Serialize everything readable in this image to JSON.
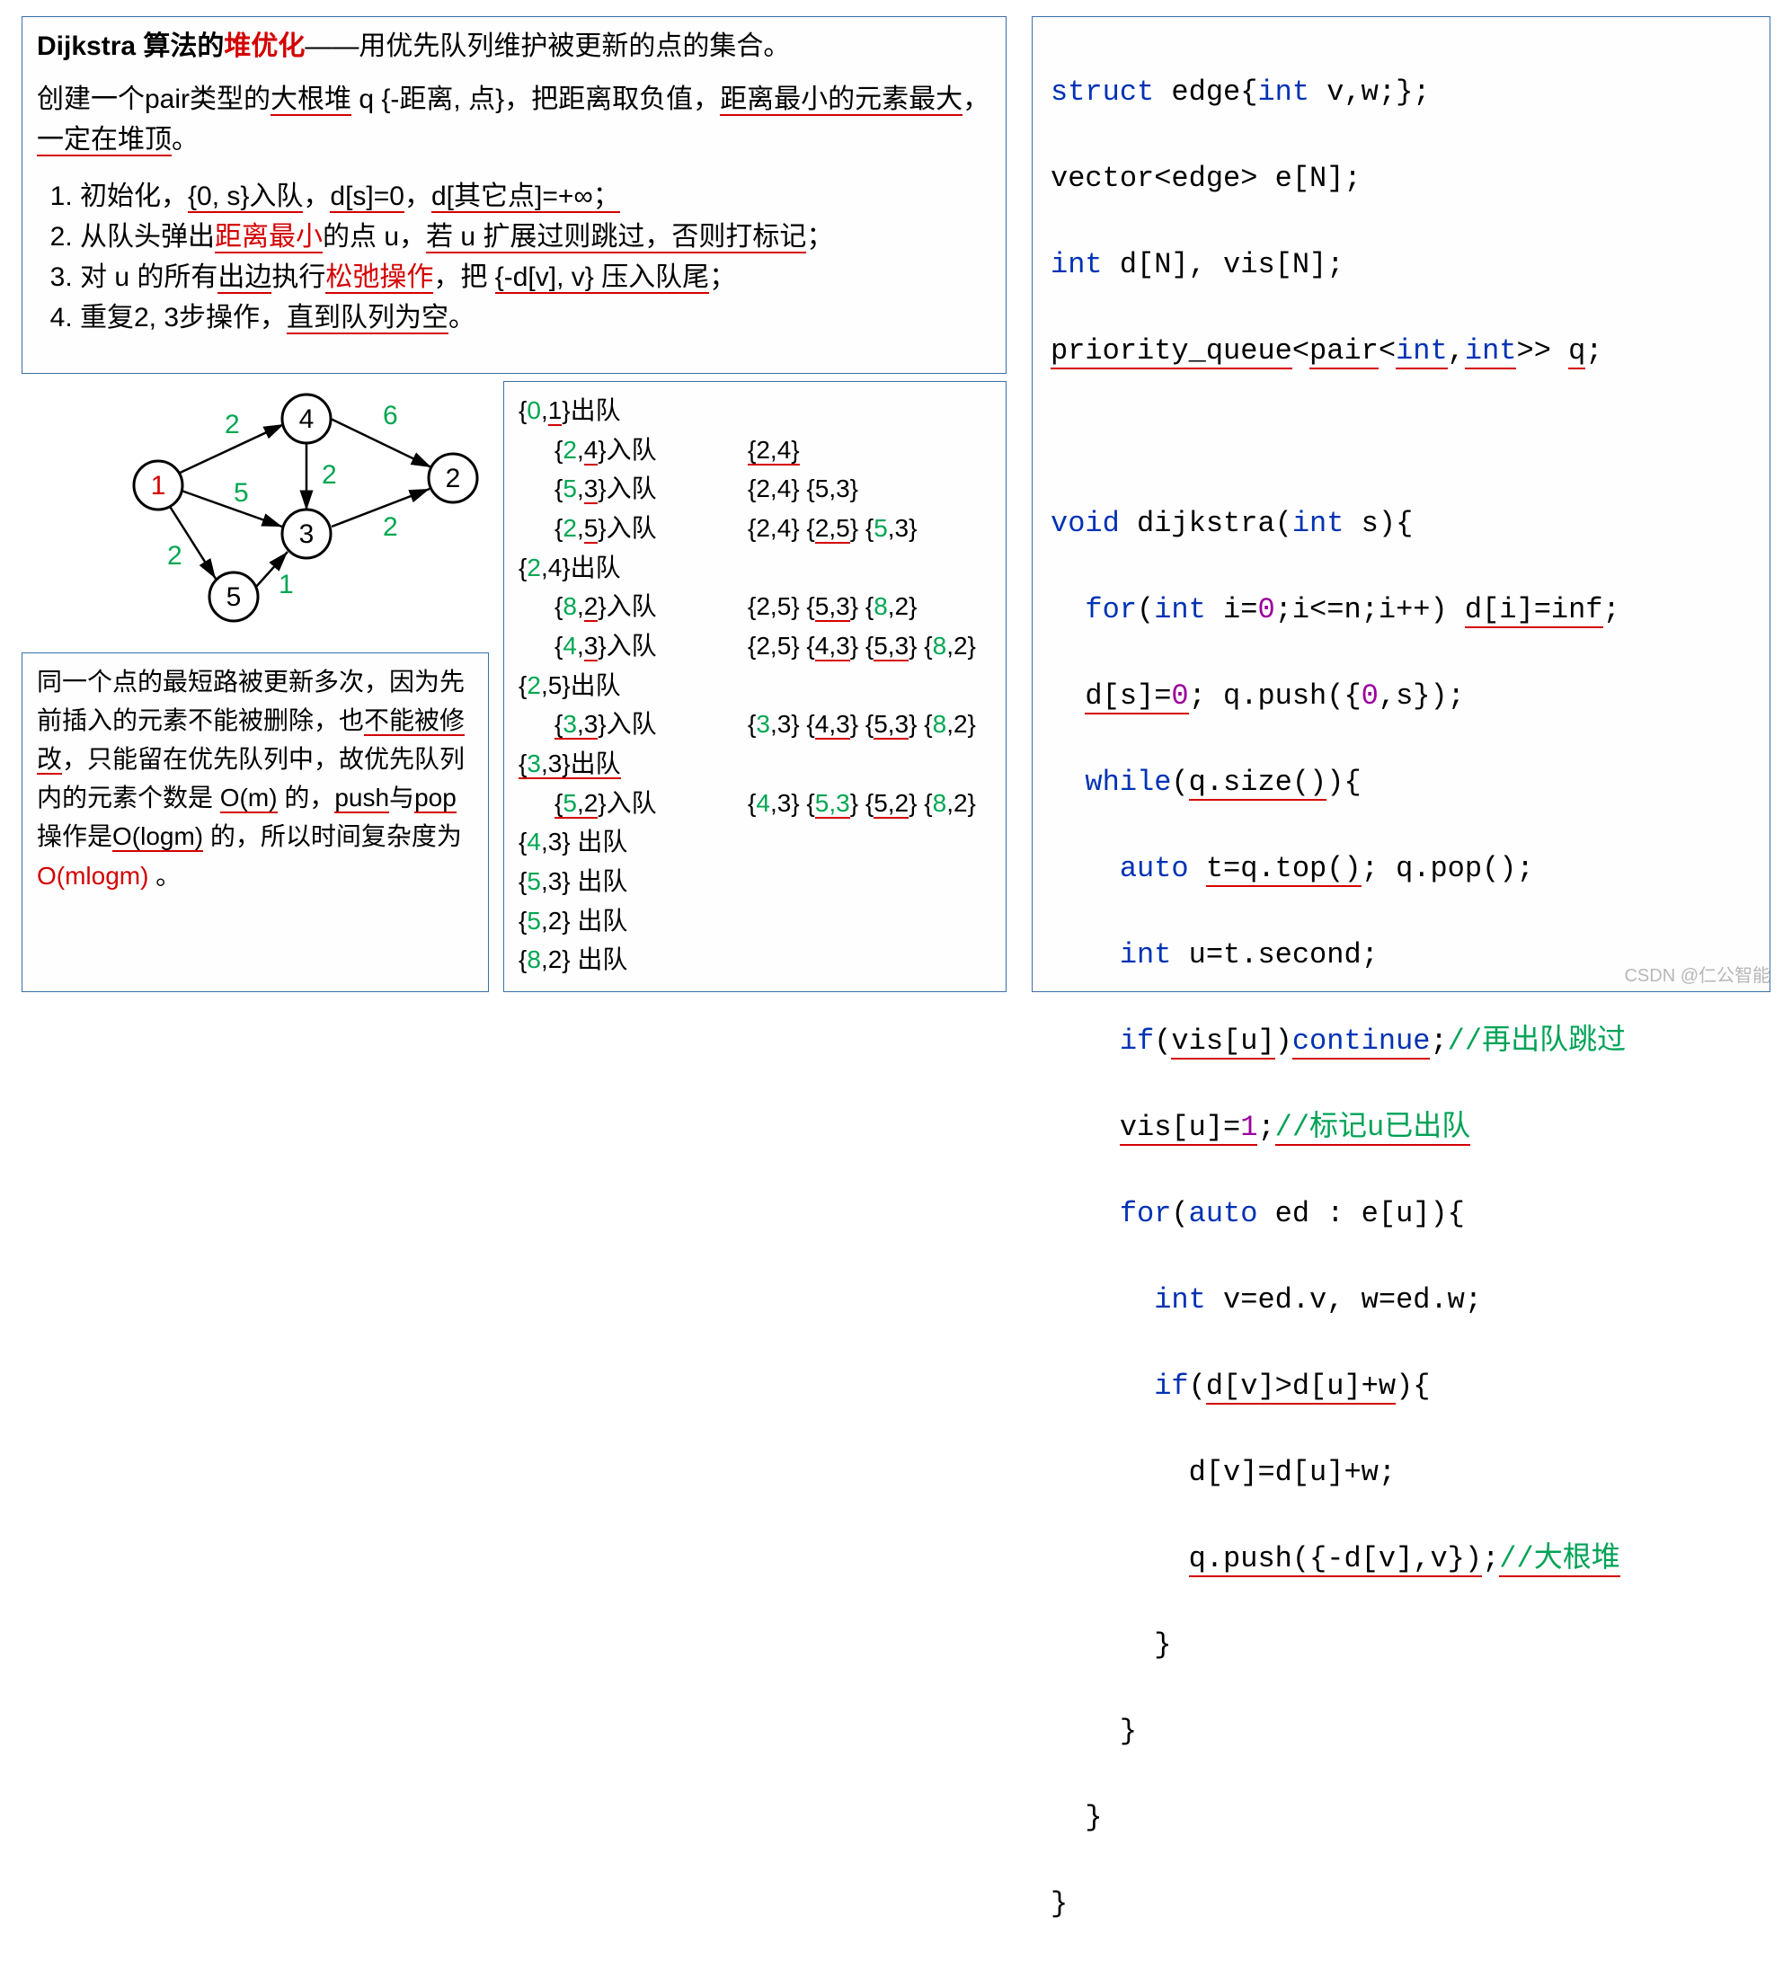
{
  "explain": {
    "title_pre": "Dijkstra 算法的",
    "title_red": "堆优化",
    "title_post": "——用优先队列维护被更新的点的集合。",
    "heap_pre": "创建一个pair类型的",
    "heap_u": "大根堆",
    "heap_mid1": " q {-距离, 点}，把距离取负值，",
    "heap_u2": "距离最小的元素最大",
    "heap_mid2": "，",
    "heap_u3": "一定在堆顶",
    "heap_end": "。",
    "steps": {
      "s1_a": "初始化，",
      "s1_b": "{0, s}入队",
      "s1_c": "，",
      "s1_d": "d[s]=0",
      "s1_e": "，",
      "s1_f": "d[其它点]=+∞；",
      "s2_a": "从队头弹出",
      "s2_b": "距离最小",
      "s2_c": "的点 u，",
      "s2_d": "若 u 扩展过则跳过，否则打标记",
      "s2_e": "；",
      "s3_a": "对 u 的所有",
      "s3_b": "出边",
      "s3_c": "执行",
      "s3_d": "松弛操作",
      "s3_e": "，把 ",
      "s3_f": "{-d[v], v} 压入队尾",
      "s3_g": "；",
      "s4_a": "重复2, 3步操作，",
      "s4_b": "直到队列为空",
      "s4_c": "。"
    }
  },
  "graph": {
    "nodes": {
      "1": "1",
      "2": "2",
      "3": "3",
      "4": "4",
      "5": "5"
    },
    "edges": {
      "e14": "2",
      "e42": "6",
      "e43": "2",
      "e13": "5",
      "e32": "2",
      "e15": "2",
      "e53": "1"
    }
  },
  "trace": {
    "l1": {
      "a": "{",
      "b": "0",
      "c": ",",
      "d": "1",
      "e": "}出队"
    },
    "l2": {
      "a": "{",
      "b": "2",
      "c": ",",
      "d": "4",
      "e": "}入队",
      "r": "{2,4}"
    },
    "l3": {
      "a": "{",
      "b": "5",
      "c": ",",
      "d": "3",
      "e": "}入队",
      "r": "{2,4} {5,3}"
    },
    "l4": {
      "a": "{",
      "b": "2",
      "c": ",",
      "d": "5",
      "e": "}入队",
      "r1": "{2,4} {",
      "r2": "2,5",
      "r3": "} {",
      "r4": "5",
      "r5": ",3}"
    },
    "l5": {
      "a": "{",
      "b": "2",
      "c": ",4}出队"
    },
    "l6": {
      "a": "{",
      "b": "8",
      "c": ",",
      "d": "2",
      "e": "}入队",
      "r1": "{2,5} {",
      "r2": "5,3",
      "r3": "} {",
      "r4": "8",
      "r5": ",2}"
    },
    "l7": {
      "a": "{",
      "b": "4",
      "c": ",",
      "d": "3",
      "e": "}入队",
      "r1": "{2,5} {",
      "r2": "4,3",
      "r3": "} {",
      "r4": "5,3",
      "r5": "} {",
      "r6": "8",
      "r7": ",2}"
    },
    "l8": {
      "a": "{",
      "b": "2",
      "c": ",5}出队"
    },
    "l9": {
      "a": "{",
      "b": "3",
      "c": ",",
      "d": "3",
      "e": "}入队",
      "r1": "{",
      "r2": "3",
      "r3": ",3} {",
      "r4": "4,3",
      "r5": "} {",
      "r6": "5,3",
      "r7": "} {",
      "r8": "8",
      "r9": ",2}"
    },
    "l10": {
      "a": "{",
      "b": "3",
      "c": ",3}出队"
    },
    "l11": {
      "a": "{",
      "b": "5",
      "c": ",",
      "d": "2",
      "e": "}入队",
      "r1": "{",
      "r2": "4",
      "r3": ",3} {",
      "r4": "5,3",
      "r5": "} {",
      "r6": "5,2",
      "r7": "} {",
      "r8": "8",
      "r9": ",2}"
    },
    "l12": {
      "a": "{",
      "b": "4",
      "c": ",",
      "d": "3",
      "e": "} 出队"
    },
    "l13": {
      "a": "{",
      "b": "5",
      "c": ",",
      "d": "3",
      "e": "} 出队"
    },
    "l14": {
      "a": "{",
      "b": "5",
      "c": ",",
      "d": "2",
      "e": "} 出队"
    },
    "l15": {
      "a": "{",
      "b": "8",
      "c": ",",
      "d": "2",
      "e": "} 出队"
    }
  },
  "note": {
    "t1": "同一个点的最短路被更新多次，因为先前插入的元素不能被删除，也",
    "t2": "不能被修改",
    "t3": "，只能留在优先队列中，故优先队列内的元素个数是 ",
    "t4": "O(m)",
    "t5": " 的，",
    "t6": "push",
    "t7": "与",
    "t8": "pop",
    "t9": "操作是",
    "t10": "O(logm)",
    "t11": " 的，所以时间复杂度为 ",
    "t12": "O(mlogm)",
    "t13": " 。"
  },
  "code": {
    "l1": {
      "a": "struct",
      "b": " edge{",
      "c": "int",
      "d": " v,w;};"
    },
    "l2": {
      "a": "vector<edge> e[N];"
    },
    "l3": {
      "a": "int",
      "b": " d[N], vis[N];"
    },
    "l4": {
      "a": "priority_queue",
      "b": "<",
      "c": "pair",
      "d": "<",
      "e": "int",
      "f": ",",
      "g": "int",
      "h": ">> ",
      "i": "q",
      ";": ";"
    },
    "l6": {
      "a": "void",
      "b": " dijkstra(",
      "c": "int",
      "d": " s){"
    },
    "l7": {
      "a": "  ",
      "b": "for",
      "c": "(",
      "d": "int",
      "e": " i=",
      "f": "0",
      "g": ";i<=n;i++) ",
      "h": "d[i]=inf",
      ";": ";"
    },
    "l8": {
      "a": "  ",
      "b": "d[s]=",
      "c": "0",
      "d": "; q.push({",
      "e": "0",
      "f": ",s});"
    },
    "l9": {
      "a": "  ",
      "b": "while",
      "c": "(",
      "d": "q.size()",
      "e": "){"
    },
    "l10": {
      "a": "    ",
      "b": "auto",
      "c": " ",
      "d": "t=q.top()",
      "e": "; q.pop();"
    },
    "l11": {
      "a": "    ",
      "b": "int",
      "c": " ",
      "d": "u=t.second",
      ";": ";"
    },
    "l12": {
      "a": "    ",
      "b": "if",
      "c": "(",
      "d": "vis[u]",
      "e": ")",
      "f": "continue",
      "g": ";",
      "h": "//再出队跳过"
    },
    "l13": {
      "a": "    ",
      "b": "vis[u]=",
      "c": "1",
      "d": ";",
      "e": "//标记u已出队"
    },
    "l14": {
      "a": "    ",
      "b": "for",
      "c": "(",
      "d": "auto",
      "e": " ed : e[u]){"
    },
    "l15": {
      "a": "      ",
      "b": "int",
      "c": " v=ed.v, w=ed.w;"
    },
    "l16": {
      "a": "      ",
      "b": "if",
      "c": "(",
      "d": "d[v]>d[u]+w",
      "e": "){"
    },
    "l17": {
      "a": "        d[v]=d[u]+w;"
    },
    "l18": {
      "a": "        ",
      "b": "q.push({-d[v],v})",
      "c": ";",
      "d": "//大根堆"
    },
    "l19": "      }",
    "l20": "    }",
    "l21": "  }",
    "l22": "}"
  },
  "watermark": "CSDN @仁公智能"
}
